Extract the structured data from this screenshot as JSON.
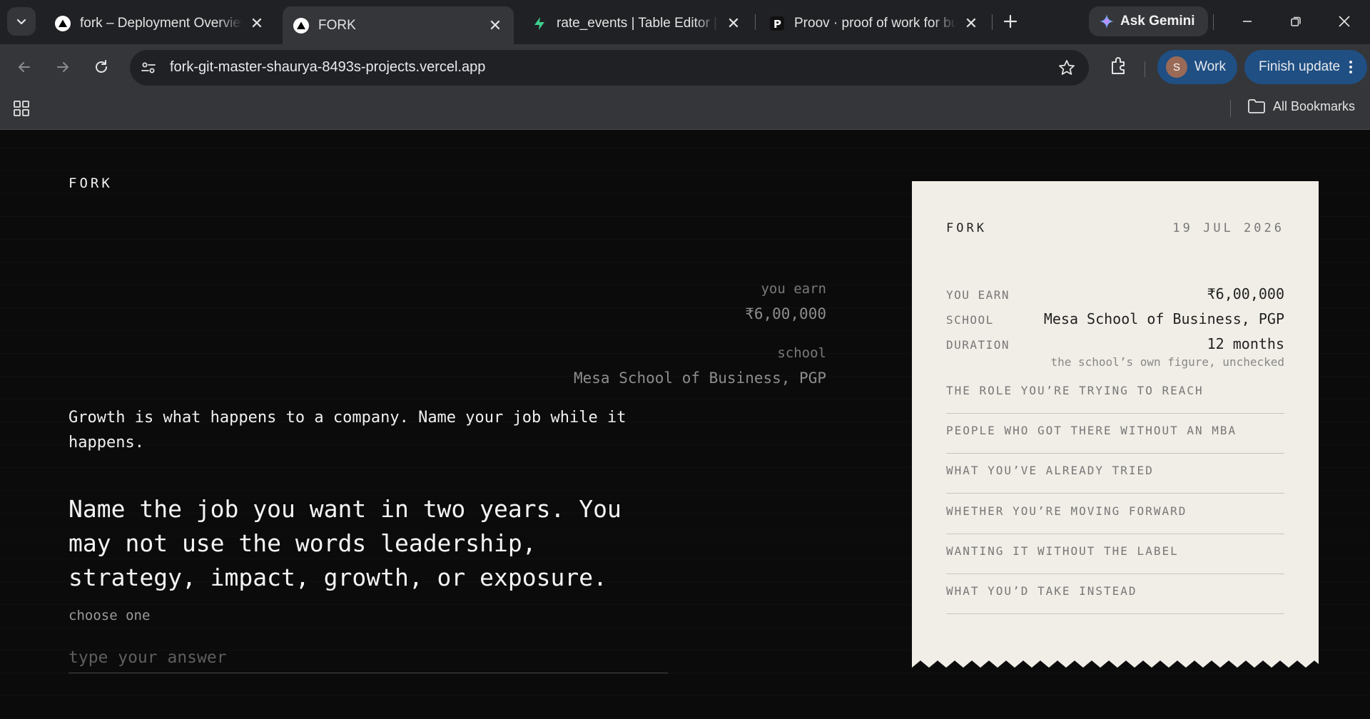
{
  "browser": {
    "tabs": [
      {
        "title": "fork – Deployment Overview",
        "favicon": "vercel-triangle-icon",
        "active": false
      },
      {
        "title": "FORK",
        "favicon": "vercel-triangle-icon",
        "active": true
      },
      {
        "title": "rate_events | Table Editor | FORK",
        "favicon": "supabase-bolt-icon",
        "active": false
      },
      {
        "title": "Proov · proof of work for builders",
        "favicon": "proov-p-icon",
        "active": false
      }
    ],
    "gemini_label": "Ask Gemini",
    "url": "fork-git-master-shaurya-8493s-projects.vercel.app",
    "profile_initial": "S",
    "profile_label": "Work",
    "finish_update_label": "Finish update",
    "all_bookmarks_label": "All Bookmarks"
  },
  "page": {
    "brand": "FORK",
    "you_earn_label": "you earn",
    "you_earn_value": "₹6,00,000",
    "school_label": "school",
    "school_value": "Mesa School of Business, PGP",
    "intro": "Growth is what happens to a company. Name your job while it happens.",
    "question": "Name the job you want in two years. You may not use the words leadership, strategy, impact, growth, or exposure.",
    "hint": "choose one",
    "answer_placeholder": "type your answer"
  },
  "receipt": {
    "brand": "FORK",
    "date": "19 JUL 2026",
    "rows": [
      {
        "key": "YOU EARN",
        "value": "₹6,00,000"
      },
      {
        "key": "SCHOOL",
        "value": "Mesa School of Business, PGP"
      },
      {
        "key": "DURATION",
        "value": "12 months"
      }
    ],
    "note": "the school’s own figure, unchecked",
    "sections": [
      "THE ROLE YOU’RE TRYING TO REACH",
      "PEOPLE WHO GOT THERE WITHOUT AN MBA",
      "WHAT YOU’VE ALREADY TRIED",
      "WHETHER YOU’RE MOVING FORWARD",
      "WANTING IT WITHOUT THE LABEL",
      "WHAT YOU’D TAKE INSTEAD"
    ]
  },
  "colors": {
    "page_bg": "#0b0b0b",
    "receipt_bg": "#f1eee7",
    "chrome_bg": "#202124",
    "toolbar_bg": "#35363a",
    "profile_bg": "#1f4f83"
  }
}
